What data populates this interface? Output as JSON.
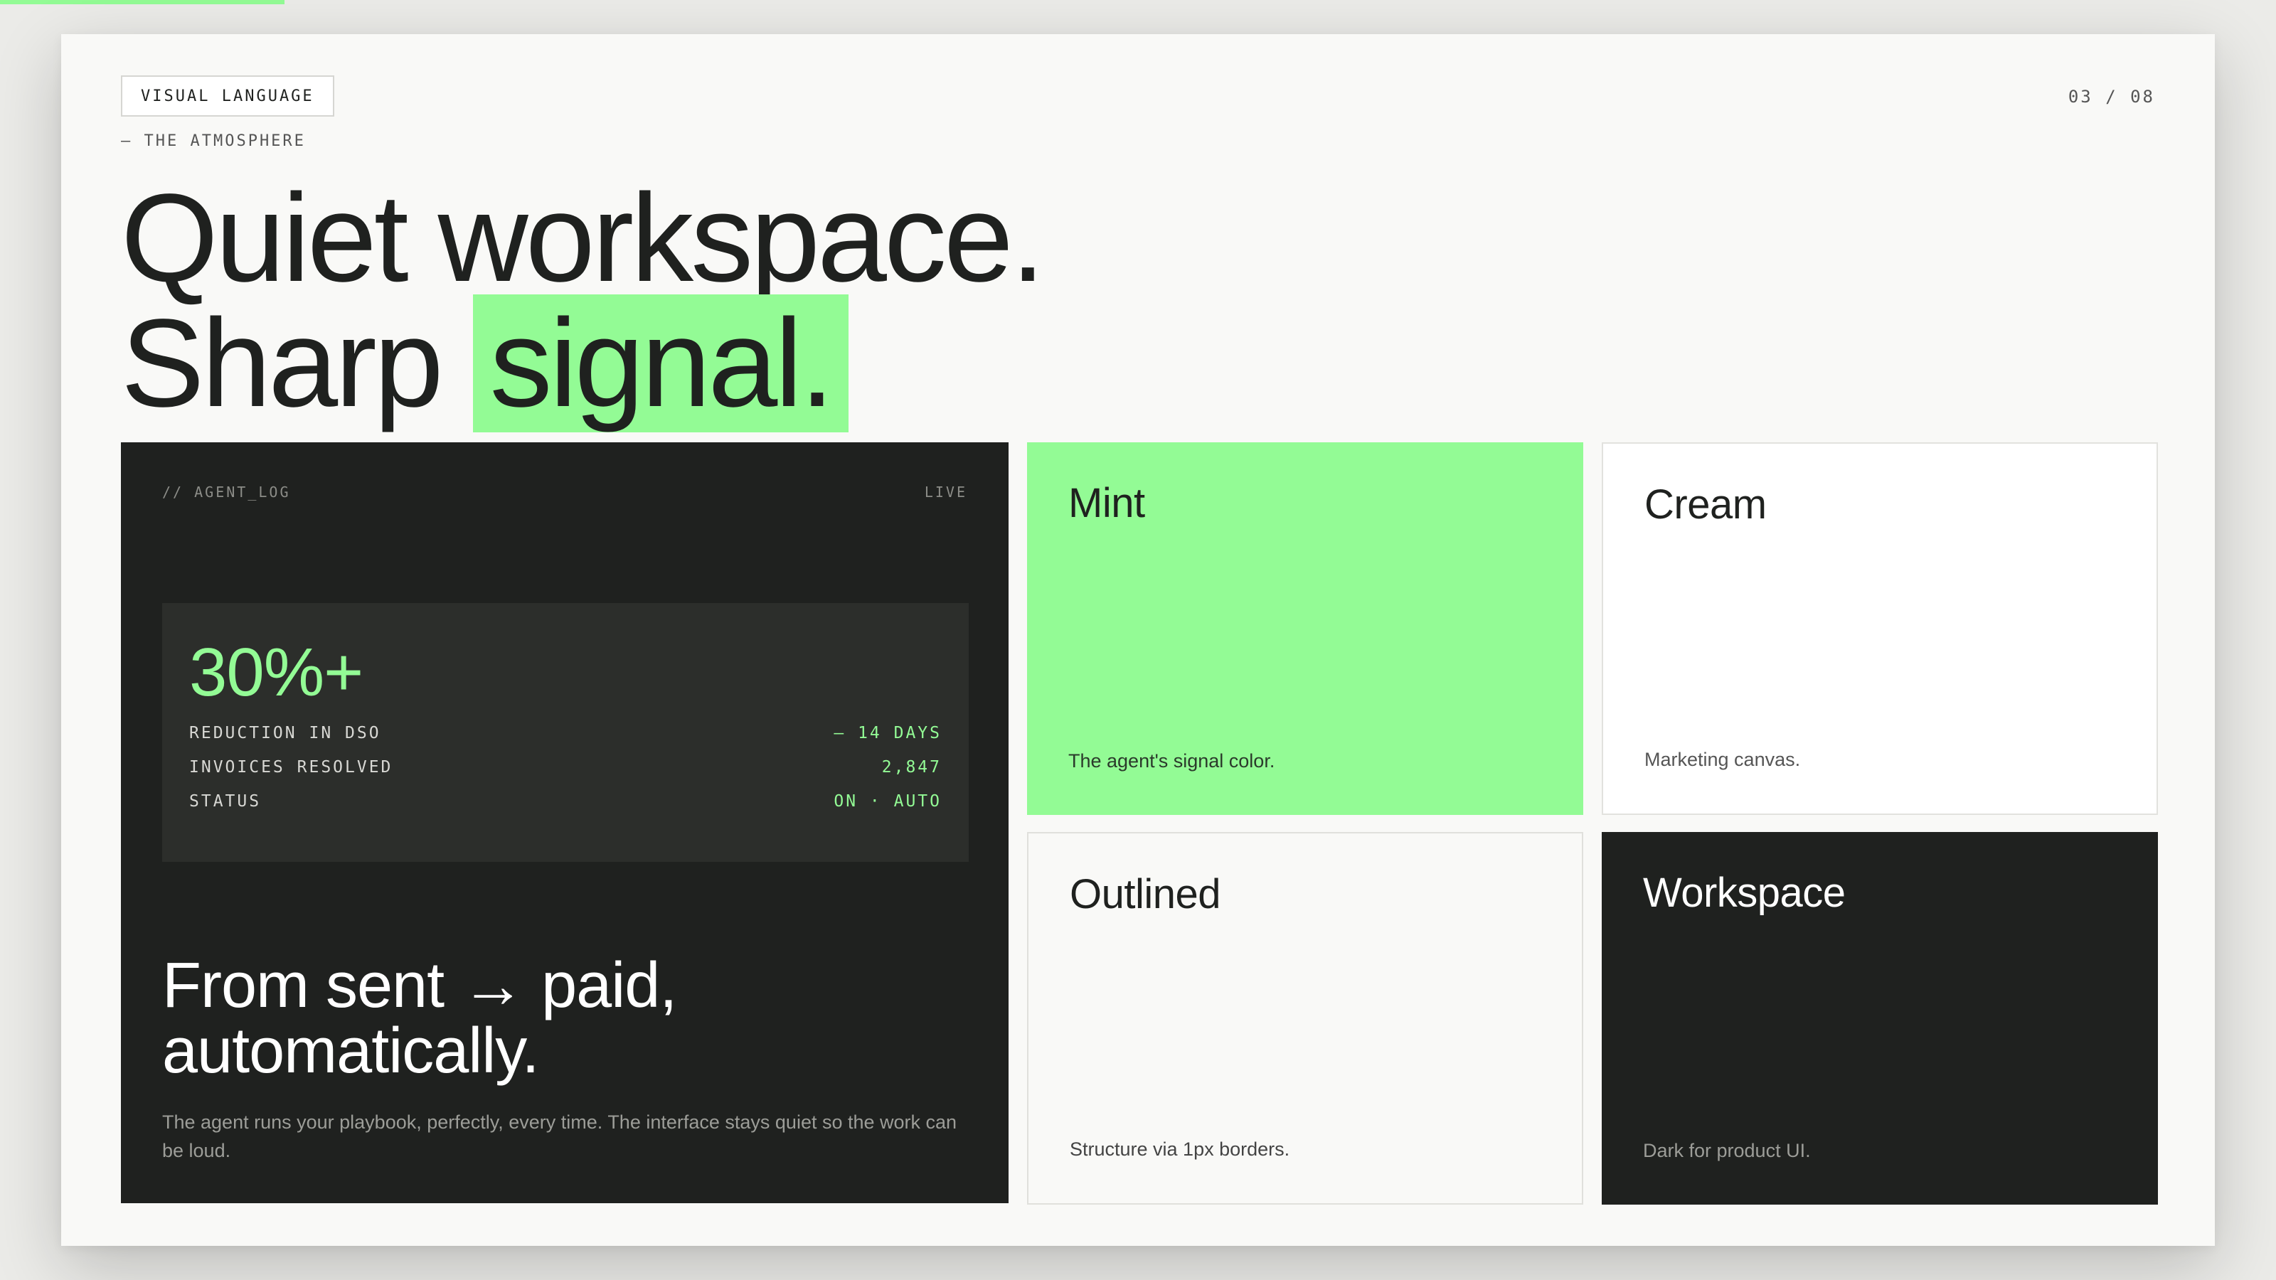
{
  "slide": {
    "tag": "VISUAL LANGUAGE",
    "eyebrow": "— THE ATMOSPHERE",
    "pager": "03 / 08",
    "headline": {
      "line1": "Quiet workspace.",
      "line2_prefix": "Sharp",
      "line2_highlight": "signal."
    }
  },
  "agent_log": {
    "label": "// AGENT_LOG",
    "status": "LIVE",
    "stat": {
      "value": "30%+",
      "rows": [
        {
          "key": "REDUCTION IN DSO",
          "value": "— 14 DAYS"
        },
        {
          "key": "INVOICES RESOLVED",
          "value": "2,847"
        },
        {
          "key": "STATUS",
          "value": "ON · AUTO"
        }
      ]
    },
    "title_line1": "From sent → paid,",
    "title_line2": "automatically.",
    "body": "The agent runs your playbook, perfectly, every time. The interface stays quiet so the work can be loud."
  },
  "swatches": {
    "mint": {
      "name": "Mint",
      "desc": "The agent's signal color."
    },
    "cream": {
      "name": "Cream",
      "desc": "Marketing canvas."
    },
    "outlined": {
      "name": "Outlined",
      "desc": "Structure via 1px borders."
    },
    "workspace": {
      "name": "Workspace",
      "desc": "Dark for product UI."
    }
  },
  "colors": {
    "mint": "#93fb95",
    "cream": "#f9f9f7",
    "workspace": "#1f211f",
    "card": "#ffffff"
  }
}
